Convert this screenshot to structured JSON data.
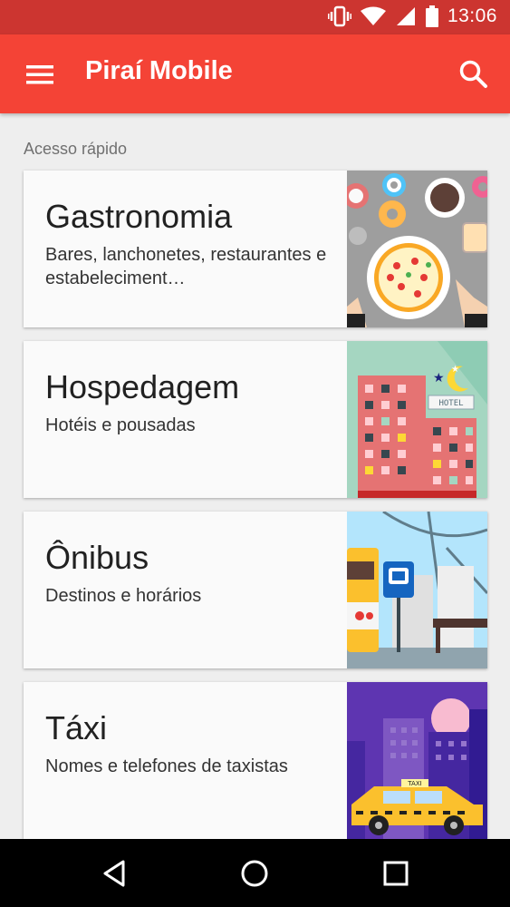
{
  "status_bar": {
    "time": "13:06"
  },
  "app_bar": {
    "title": "Piraí Mobile"
  },
  "section": {
    "label": "Acesso rápido"
  },
  "cards": [
    {
      "title": "Gastronomia",
      "subtitle": "Bares, lanchonetes, restaurantes e estabeleciment…"
    },
    {
      "title": "Hospedagem",
      "subtitle": "Hotéis e pousadas"
    },
    {
      "title": "Ônibus",
      "subtitle": "Destinos e horários"
    },
    {
      "title": "Táxi",
      "subtitle": "Nomes e telefones de taxistas"
    }
  ],
  "images": {
    "hotel_sign": "HOTEL",
    "taxi_sign": "TAXI"
  },
  "colors": {
    "primary": "#f44336",
    "primary_dark": "#cc3530"
  }
}
